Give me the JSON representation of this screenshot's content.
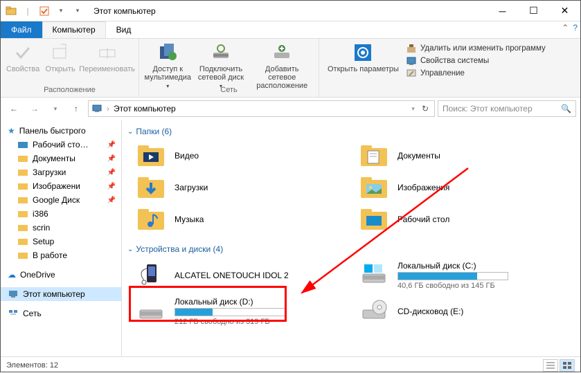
{
  "title": "Этот компьютер",
  "tabs": {
    "file": "Файл",
    "computer": "Компьютер",
    "view": "Вид"
  },
  "ribbon": {
    "location": {
      "label": "Расположение",
      "props": "Свойства",
      "open": "Открыть",
      "rename": "Переименовать"
    },
    "network": {
      "label": "Сеть",
      "media": "Доступ к\nмультимедиа",
      "mapdrive": "Подключить\nсетевой диск",
      "addloc": "Добавить сетевое\nрасположение"
    },
    "system": {
      "openparams": "Открыть\nпараметры",
      "uninstall": "Удалить или изменить программу",
      "sysprops": "Свойства системы",
      "manage": "Управление"
    }
  },
  "address": {
    "location": "Этот компьютер",
    "search_placeholder": "Поиск: Этот компьютер"
  },
  "sidebar": {
    "quick": "Панель быстрого",
    "items_pinned": [
      "Рабочий сто…",
      "Документы",
      "Загрузки",
      "Изображени",
      "Google Диск"
    ],
    "items_plain": [
      "i386",
      "scrin",
      "Setup",
      "В работе"
    ],
    "onedrive": "OneDrive",
    "thispc": "Этот компьютер",
    "network": "Сеть"
  },
  "sections": {
    "folders_header": "Папки (6)",
    "drives_header": "Устройства и диски (4)"
  },
  "folders": {
    "videos": "Видео",
    "documents": "Документы",
    "downloads": "Загрузки",
    "pictures": "Изображения",
    "music": "Музыка",
    "desktop": "Рабочий стол"
  },
  "drives": {
    "device": "ALCATEL ONETOUCH IDOL 2",
    "c_name": "Локальный диск (C:)",
    "c_free": "40,6 ГБ свободно из 145 ГБ",
    "c_fill": 72,
    "d_name": "Локальный диск (D:)",
    "d_free": "212 ГБ свободно из 319 ГБ",
    "d_fill": 34,
    "cd_name": "CD-дисковод (E:)"
  },
  "status": "Элементов: 12"
}
